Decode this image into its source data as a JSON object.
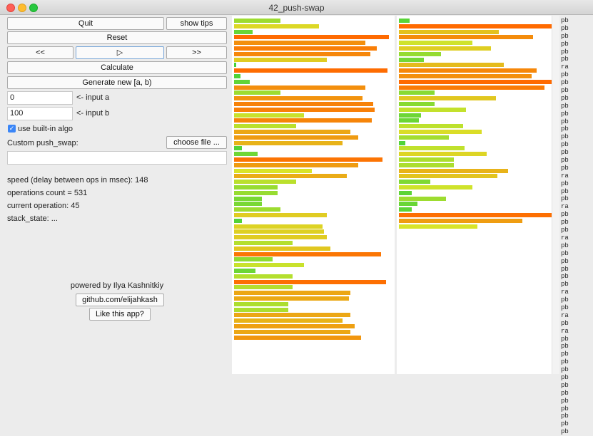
{
  "window": {
    "title": "42_push-swap"
  },
  "buttons": {
    "quit": "Quit",
    "show_tips": "show tips",
    "reset": "Reset",
    "prev": "<<",
    "play": "▷",
    "next": ">>",
    "calculate": "Calculate",
    "generate": "Generate new [a, b)",
    "choose_file": "choose file ...",
    "github": "github.com/elijahkash",
    "like": "Like this app?"
  },
  "inputs": {
    "a_value": "0",
    "a_label": "<- input a",
    "b_value": "100",
    "b_label": "<- input b"
  },
  "options": {
    "builtin_label": "use built-in algo",
    "builtin_checked": true
  },
  "custom": {
    "label": "Custom push_swap:",
    "value": ""
  },
  "status": {
    "speed": "speed (delay between ops in msec): 148",
    "ops_count": "operations count = 531",
    "current_op": "current operation: 45",
    "stack_state": "stack_state: ..."
  },
  "credits": {
    "powered_by": "powered by Ilya Kashnitkiy"
  },
  "stack_a": [
    30,
    55,
    12,
    100,
    85,
    92,
    88,
    60,
    1,
    99,
    4,
    10,
    85,
    30,
    83,
    90,
    91,
    45,
    89,
    40,
    75,
    80,
    70,
    5,
    15,
    96,
    80,
    50,
    73,
    40,
    28,
    28,
    18,
    18,
    30,
    60,
    5,
    57,
    58,
    60,
    38,
    62,
    95,
    25,
    45,
    14,
    38,
    98,
    38,
    75,
    74,
    35,
    35,
    75,
    70,
    78,
    75,
    82
  ],
  "stack_b": [
    7,
    100,
    64,
    86,
    47,
    59,
    27,
    16,
    67,
    88,
    85,
    100,
    93,
    23,
    62,
    23,
    43,
    14,
    13,
    41,
    53,
    32,
    4,
    42,
    56,
    35,
    35,
    70,
    63,
    20,
    47,
    8,
    30,
    12,
    8,
    98,
    79,
    50
  ],
  "ops": [
    "pb",
    "pb",
    "pb",
    "pb",
    "pb",
    "pb",
    "ra",
    "pb",
    "pb",
    "pb",
    "pb",
    "pb",
    "pb",
    "pb",
    "pb",
    "pb",
    "pb",
    "pb",
    "pb",
    "pb",
    "ra",
    "pb",
    "pb",
    "pb",
    "ra",
    "pb",
    "pb",
    "pb",
    "ra",
    "pb",
    "pb",
    "pb",
    "pb",
    "pb",
    "pb",
    "ra",
    "pb",
    "pb",
    "ra",
    "pb",
    "ra",
    "pb",
    "pb",
    "pb",
    "pb",
    "pb",
    "pb",
    "pb",
    "pb",
    "pb",
    "pb",
    "pb",
    "pb",
    "pb"
  ],
  "colors": {
    "low": "#44d13a",
    "mid": "#d8e42a",
    "high": "#ff6a00"
  }
}
